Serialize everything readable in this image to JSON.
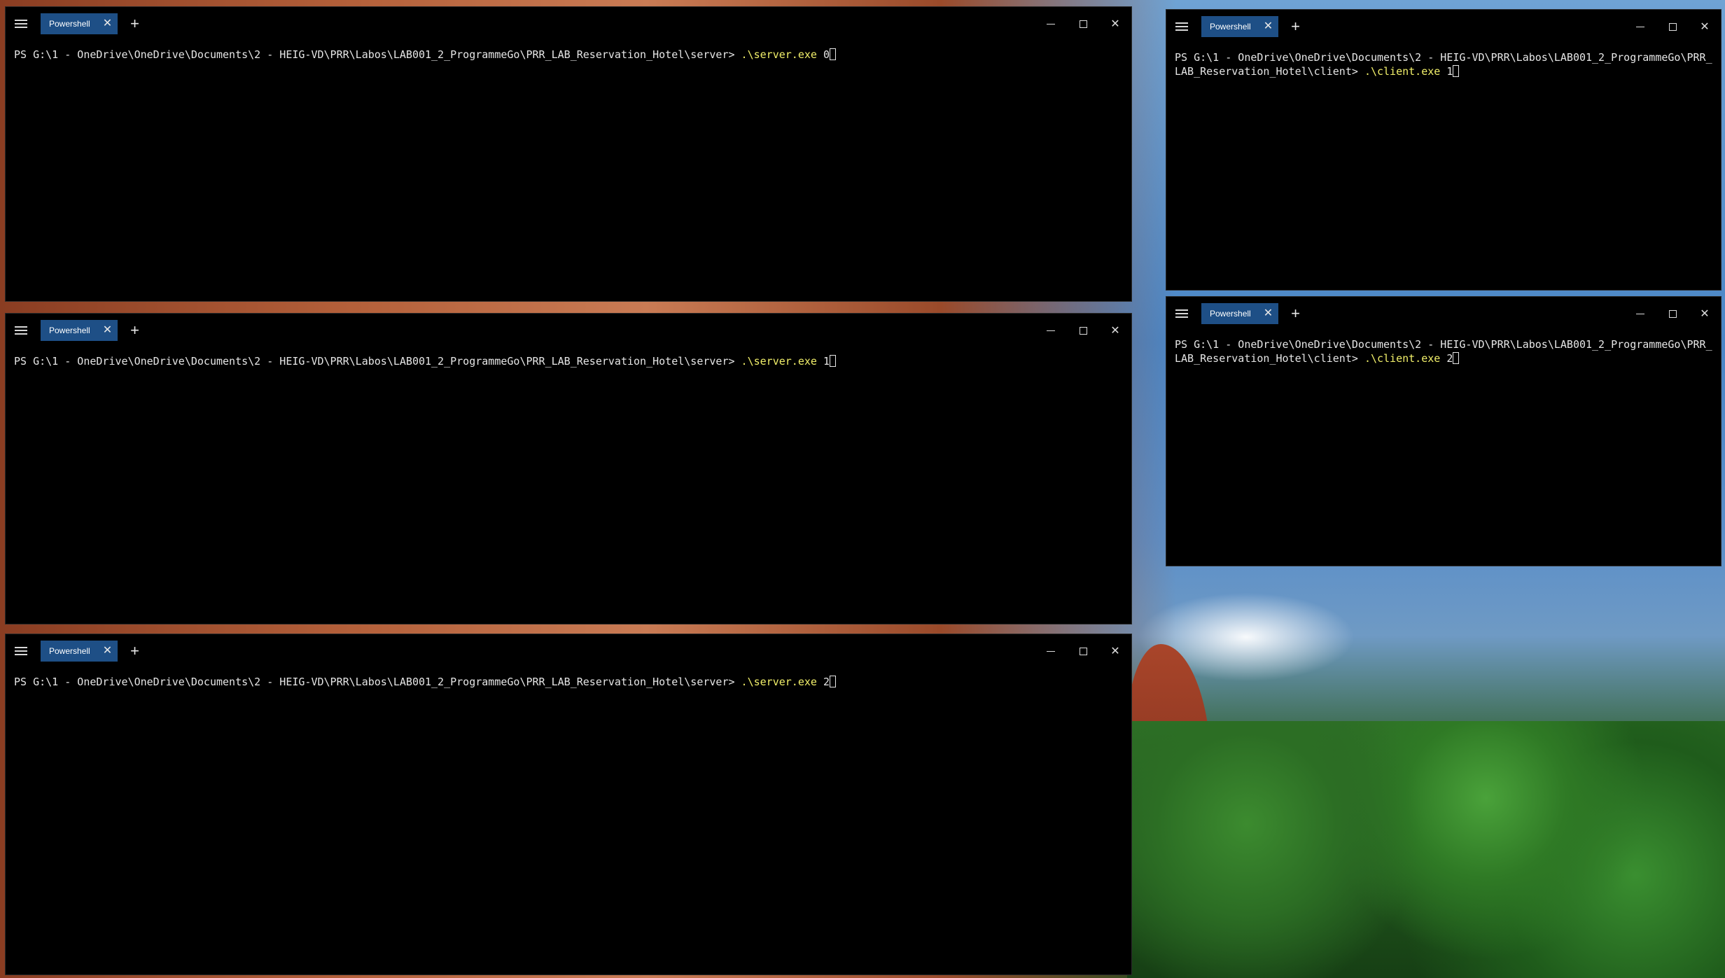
{
  "desktop": {
    "wallpaper": "canyon-forest-sky",
    "colors": {
      "terminal_bg": "#000000",
      "tab_active": "#1e4f86",
      "prompt_text": "#e6e6e6",
      "command_text": "#f2f06a"
    }
  },
  "windows": [
    {
      "tab_label": "Powershell",
      "prompt": "PS G:\\1 - OneDrive\\OneDrive\\Documents\\2 - HEIG-VD\\PRR\\Labos\\LAB001_2_ProgrammeGo\\PRR_LAB_Reservation_Hotel\\server> ",
      "command": ".\\server.exe",
      "argument": " 0"
    },
    {
      "tab_label": "Powershell",
      "prompt": "PS G:\\1 - OneDrive\\OneDrive\\Documents\\2 - HEIG-VD\\PRR\\Labos\\LAB001_2_ProgrammeGo\\PRR_LAB_Reservation_Hotel\\server> ",
      "command": ".\\server.exe",
      "argument": " 1"
    },
    {
      "tab_label": "Powershell",
      "prompt": "PS G:\\1 - OneDrive\\OneDrive\\Documents\\2 - HEIG-VD\\PRR\\Labos\\LAB001_2_ProgrammeGo\\PRR_LAB_Reservation_Hotel\\server> ",
      "command": ".\\server.exe",
      "argument": " 2"
    },
    {
      "tab_label": "Powershell",
      "prompt": "PS G:\\1 - OneDrive\\OneDrive\\Documents\\2 - HEIG-VD\\PRR\\Labos\\LAB001_2_ProgrammeGo\\PRR_LAB_Reservation_Hotel\\client> ",
      "command": ".\\client.exe",
      "argument": " 1"
    },
    {
      "tab_label": "Powershell",
      "prompt": "PS G:\\1 - OneDrive\\OneDrive\\Documents\\2 - HEIG-VD\\PRR\\Labos\\LAB001_2_ProgrammeGo\\PRR_LAB_Reservation_Hotel\\client> ",
      "command": ".\\client.exe",
      "argument": " 2"
    }
  ],
  "icons": {
    "menu": "hamburger-menu-icon",
    "tab_close": "close-icon",
    "new_tab": "plus-icon",
    "minimize": "minimize-icon",
    "maximize": "maximize-icon",
    "close": "close-icon"
  }
}
